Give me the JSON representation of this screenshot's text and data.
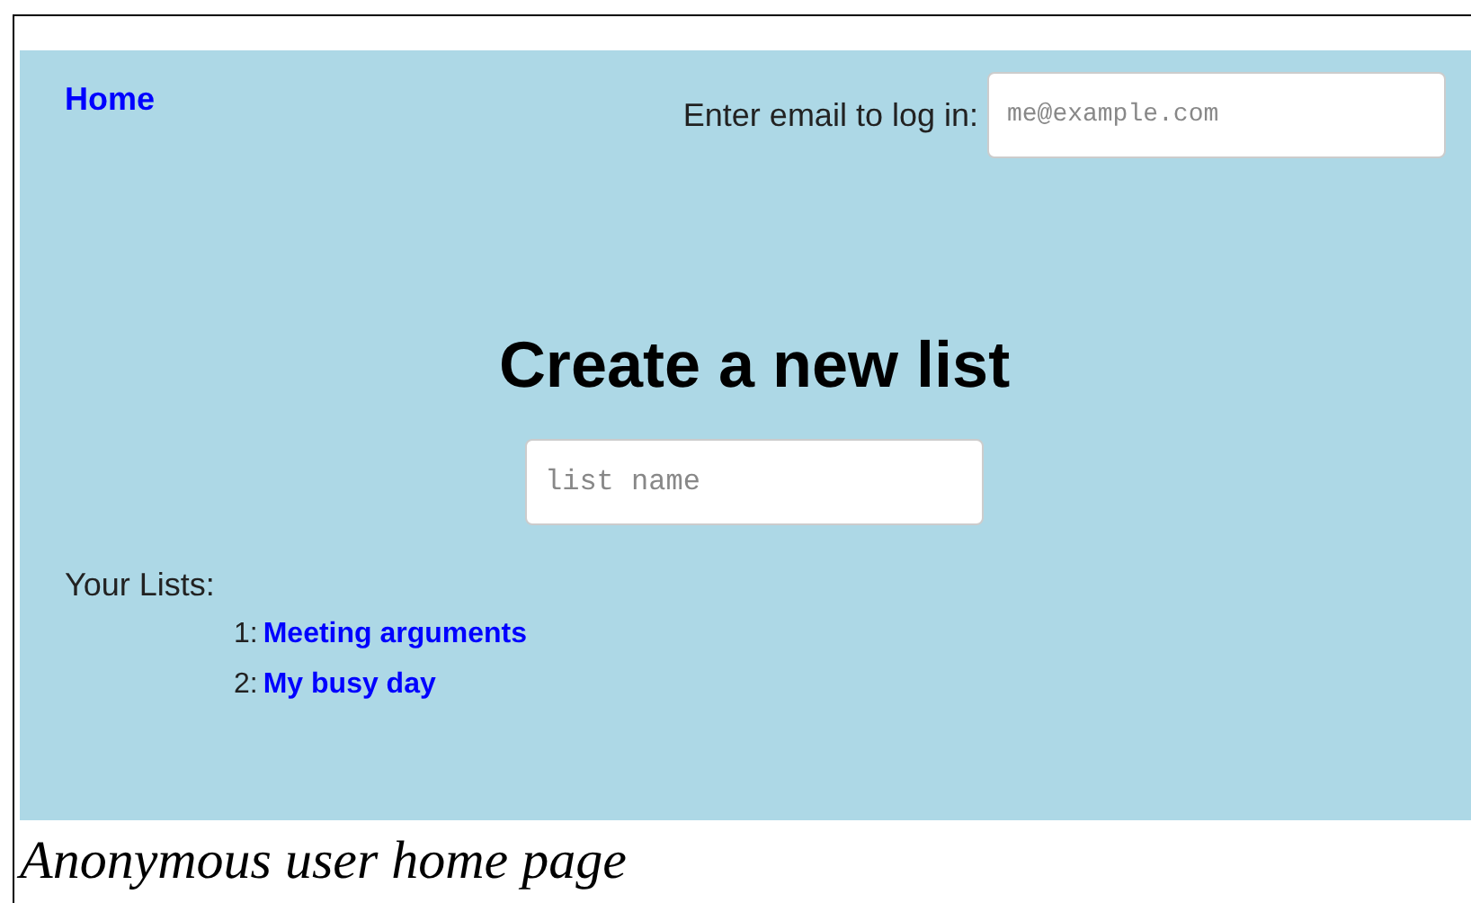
{
  "nav": {
    "home_link": "Home",
    "login_label": "Enter email to log in:",
    "email_field": {
      "placeholder": "me@example.com"
    }
  },
  "main": {
    "heading": "Create a new list",
    "list_name_field": {
      "placeholder": "list name"
    }
  },
  "your_lists": {
    "label": "Your Lists:",
    "items": [
      {
        "number": "1:",
        "name": "Meeting arguments"
      },
      {
        "number": "2:",
        "name": "My busy day"
      }
    ]
  },
  "caption": "Anonymous user home page"
}
